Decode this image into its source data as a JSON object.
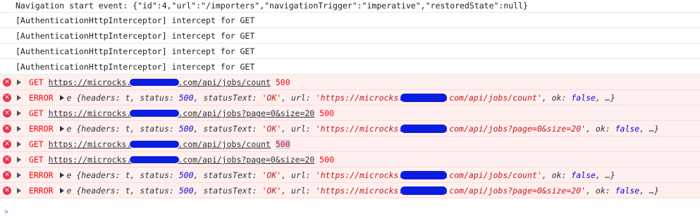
{
  "logs": [
    {
      "text": "Navigation start event: {\"id\":4,\"url\":\"/importers\",\"navigationTrigger\":\"imperative\",\"restoredState\":null}"
    },
    {
      "text": "[AuthenticationHttpInterceptor] intercept for GET"
    },
    {
      "text": "[AuthenticationHttpInterceptor] intercept for GET"
    },
    {
      "text": "[AuthenticationHttpInterceptor] intercept for GET"
    },
    {
      "text": "[AuthenticationHttpInterceptor] intercept for GET"
    }
  ],
  "errors": [
    {
      "kind": "GET",
      "url_prefix": "https://microcks.",
      "url_suffix": ".com/api/jobs/count",
      "status": "500"
    },
    {
      "kind": "ERROR",
      "obj_prefix": "e {headers: t, status: ",
      "obj_status": "500",
      "obj_mid": ", statusText: ",
      "obj_text": "'OK'",
      "obj_url_label": ", url: ",
      "obj_url_prefix": "'https://microcks.",
      "obj_url_suffix": ".com/api/jobs/count'",
      "obj_ok": ", ok: ",
      "obj_ok_val": "false",
      "obj_end": ", …}"
    },
    {
      "kind": "GET",
      "url_prefix": "https://microcks.",
      "url_suffix": ".com/api/jobs?page=0&size=20",
      "status": "500"
    },
    {
      "kind": "ERROR",
      "obj_prefix": "e {headers: t, status: ",
      "obj_status": "500",
      "obj_mid": ", statusText: ",
      "obj_text": "'OK'",
      "obj_url_label": ", url: ",
      "obj_url_prefix": "'https://microcks.",
      "obj_url_suffix": ".com/api/jobs?page=0&size=20'",
      "obj_ok": ", ok: ",
      "obj_ok_val": "false",
      "obj_end": ", …}"
    },
    {
      "kind": "GET",
      "url_prefix": "https://microcks.",
      "url_suffix": ".com/api/jobs/count",
      "status": "500"
    },
    {
      "kind": "GET",
      "url_prefix": "https://microcks.",
      "url_suffix": ".com/api/jobs?page=0&size=20",
      "status": "500"
    },
    {
      "kind": "ERROR",
      "obj_prefix": "e {headers: t, status: ",
      "obj_status": "500",
      "obj_mid": ", statusText: ",
      "obj_text": "'OK'",
      "obj_url_label": ", url: ",
      "obj_url_prefix": "'https://microcks.",
      "obj_url_suffix": ".com/api/jobs/count'",
      "obj_ok": ", ok: ",
      "obj_ok_val": "false",
      "obj_end": ", …}"
    },
    {
      "kind": "ERROR",
      "obj_prefix": "e {headers: t, status: ",
      "obj_status": "500",
      "obj_mid": ", statusText: ",
      "obj_text": "'OK'",
      "obj_url_label": ", url: ",
      "obj_url_prefix": "'https://microcks.",
      "obj_url_suffix": ".com/api/jobs?page=0&size=20'",
      "obj_ok": ", ok: ",
      "obj_ok_val": "false",
      "obj_end": ", …}"
    }
  ],
  "icons": {
    "error": "error-circle-icon",
    "expand": "expand-triangle-icon",
    "prompt": "console-prompt-icon"
  },
  "colors": {
    "error_text": "#ff0000",
    "error_bg": "#fff0f0",
    "redaction": "#0a1de0",
    "error_icon": "#e8364a"
  },
  "prompt_glyph": ">"
}
